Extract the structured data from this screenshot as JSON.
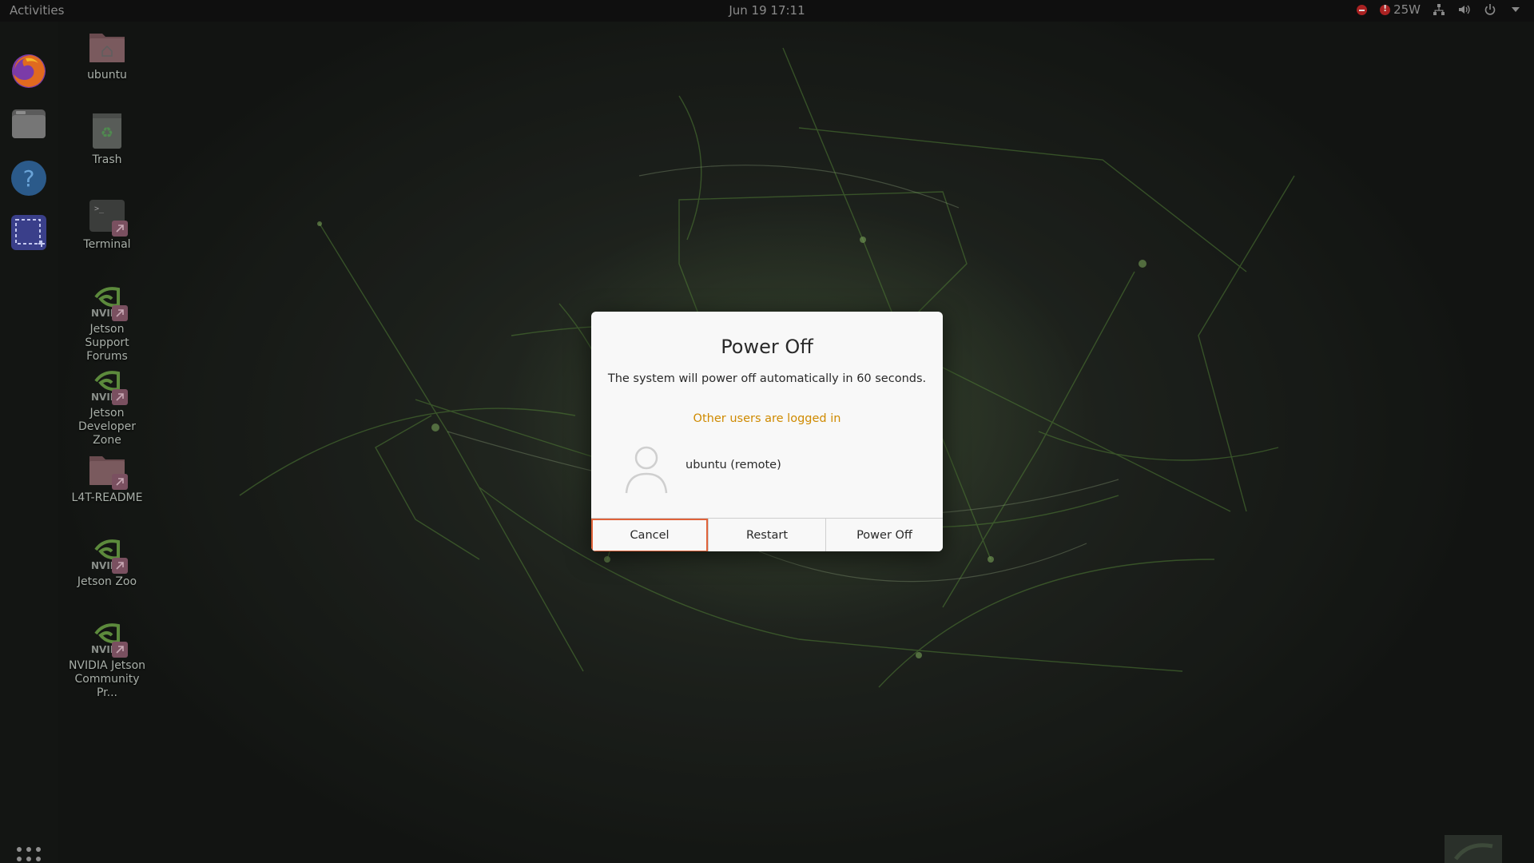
{
  "topbar": {
    "activities": "Activities",
    "clock": "Jun 19  17:11",
    "power_mode": "25W"
  },
  "dock": {
    "items": [
      {
        "name": "firefox-icon"
      },
      {
        "name": "files-icon"
      },
      {
        "name": "help-icon"
      },
      {
        "name": "screenshot-icon"
      }
    ]
  },
  "desktop": {
    "icons": [
      {
        "label": "ubuntu",
        "icon": "home-folder-icon"
      },
      {
        "label": "Trash",
        "icon": "trash-icon"
      },
      {
        "label": "Terminal",
        "icon": "terminal-icon"
      },
      {
        "label": "Jetson Support\nForums",
        "icon": "nvidia-icon"
      },
      {
        "label": "Jetson\nDeveloper Zone",
        "icon": "nvidia-icon"
      },
      {
        "label": "L4T-README",
        "icon": "folder-icon"
      },
      {
        "label": "Jetson Zoo",
        "icon": "nvidia-icon"
      },
      {
        "label": "NVIDIA Jetson\nCommunity Pr...",
        "icon": "nvidia-icon"
      }
    ]
  },
  "dialog": {
    "title": "Power Off",
    "message": "The system will power off automatically in 60 seconds.",
    "warning": "Other users are logged in",
    "user": "ubuntu (remote)",
    "buttons": {
      "cancel": "Cancel",
      "restart": "Restart",
      "power_off": "Power Off"
    }
  },
  "colors": {
    "warning": "#cf8a00",
    "focus_ring": "#e0633a",
    "dialog_bg": "#f8f8f8",
    "topbar_bg": "#0f0f0f"
  }
}
